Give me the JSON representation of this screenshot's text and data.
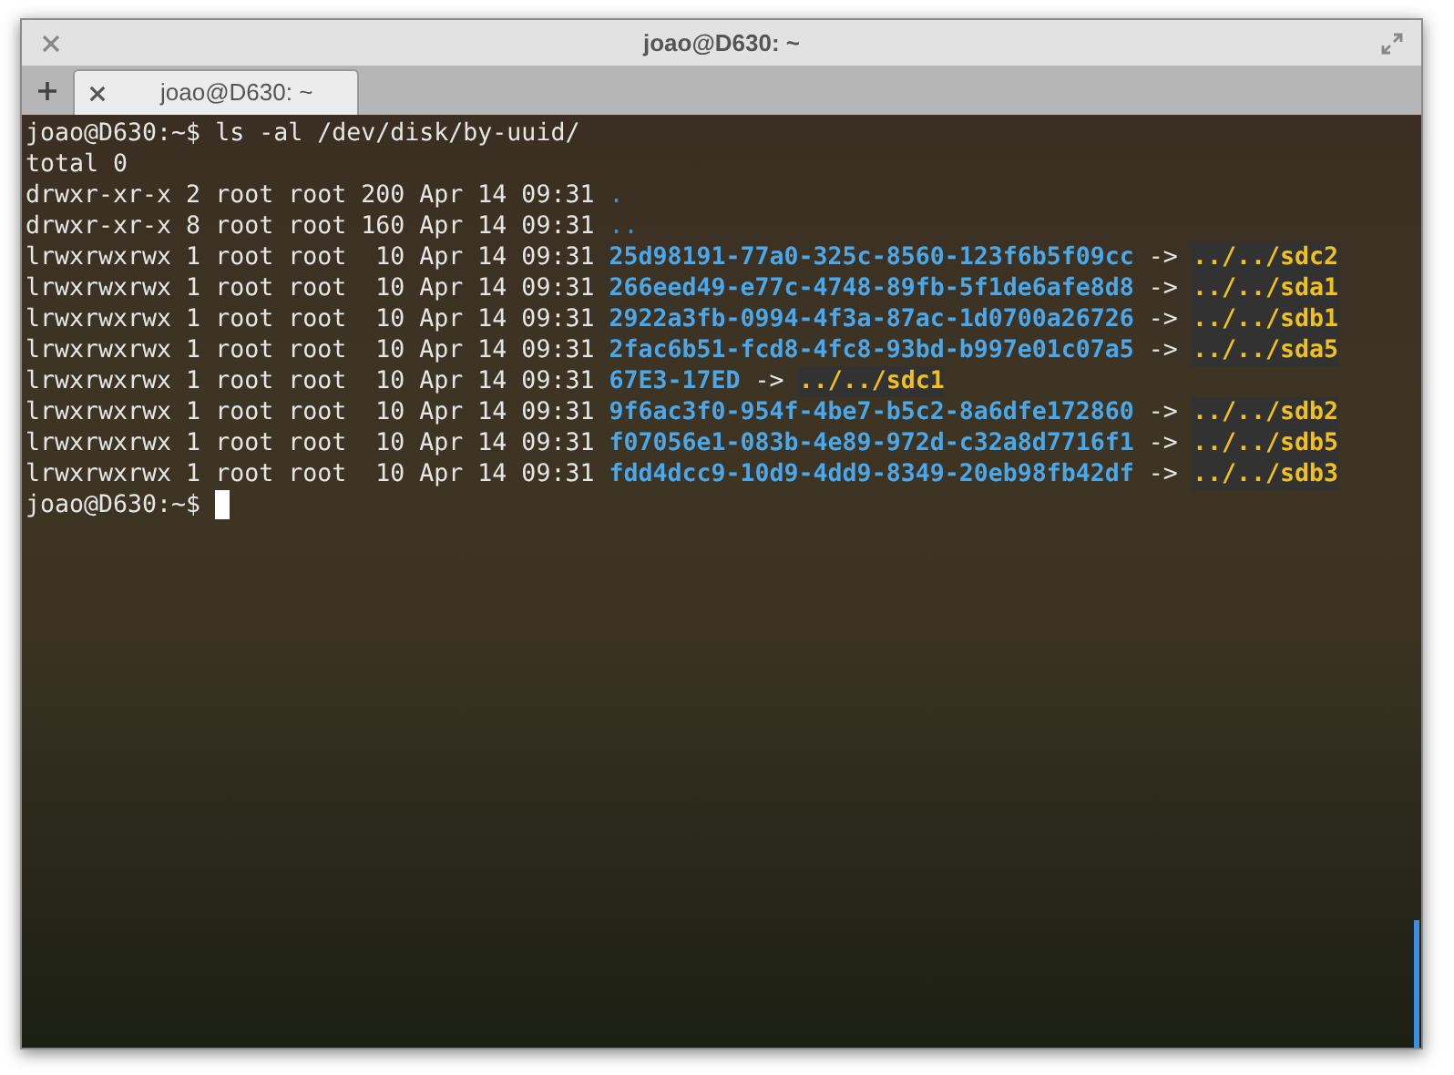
{
  "window": {
    "title": "joao@D630: ~"
  },
  "tabs": [
    {
      "label": "joao@D630: ~",
      "selected": true
    }
  ],
  "terminal": {
    "lines": [
      {
        "segments": [
          {
            "kind": "plain",
            "text": "joao@D630:~$ ls -al /dev/disk/by-uuid/"
          }
        ]
      },
      {
        "segments": [
          {
            "kind": "plain",
            "text": "total 0"
          }
        ]
      },
      {
        "segments": [
          {
            "kind": "plain",
            "text": "drwxr-xr-x 2 root root 200 Apr 14 09:31 "
          },
          {
            "kind": "dir",
            "text": "."
          }
        ]
      },
      {
        "segments": [
          {
            "kind": "plain",
            "text": "drwxr-xr-x 8 root root 160 Apr 14 09:31 "
          },
          {
            "kind": "dir",
            "text": ".."
          }
        ]
      },
      {
        "segments": [
          {
            "kind": "plain",
            "text": "lrwxrwxrwx 1 root root  10 Apr 14 09:31 "
          },
          {
            "kind": "link",
            "text": "25d98191-77a0-325c-8560-123f6b5f09cc"
          },
          {
            "kind": "plain",
            "text": " -> "
          },
          {
            "kind": "target",
            "text": "../../sdc2"
          }
        ]
      },
      {
        "segments": [
          {
            "kind": "plain",
            "text": "lrwxrwxrwx 1 root root  10 Apr 14 09:31 "
          },
          {
            "kind": "link",
            "text": "266eed49-e77c-4748-89fb-5f1de6afe8d8"
          },
          {
            "kind": "plain",
            "text": " -> "
          },
          {
            "kind": "target",
            "text": "../../sda1"
          }
        ]
      },
      {
        "segments": [
          {
            "kind": "plain",
            "text": "lrwxrwxrwx 1 root root  10 Apr 14 09:31 "
          },
          {
            "kind": "link",
            "text": "2922a3fb-0994-4f3a-87ac-1d0700a26726"
          },
          {
            "kind": "plain",
            "text": " -> "
          },
          {
            "kind": "target",
            "text": "../../sdb1"
          }
        ]
      },
      {
        "segments": [
          {
            "kind": "plain",
            "text": "lrwxrwxrwx 1 root root  10 Apr 14 09:31 "
          },
          {
            "kind": "link",
            "text": "2fac6b51-fcd8-4fc8-93bd-b997e01c07a5"
          },
          {
            "kind": "plain",
            "text": " -> "
          },
          {
            "kind": "target",
            "text": "../../sda5"
          }
        ]
      },
      {
        "segments": [
          {
            "kind": "plain",
            "text": "lrwxrwxrwx 1 root root  10 Apr 14 09:31 "
          },
          {
            "kind": "link",
            "text": "67E3-17ED"
          },
          {
            "kind": "plain",
            "text": " -> "
          },
          {
            "kind": "target",
            "text": "../../sdc1"
          }
        ]
      },
      {
        "segments": [
          {
            "kind": "plain",
            "text": "lrwxrwxrwx 1 root root  10 Apr 14 09:31 "
          },
          {
            "kind": "link",
            "text": "9f6ac3f0-954f-4be7-b5c2-8a6dfe172860"
          },
          {
            "kind": "plain",
            "text": " -> "
          },
          {
            "kind": "target",
            "text": "../../sdb2"
          }
        ]
      },
      {
        "segments": [
          {
            "kind": "plain",
            "text": "lrwxrwxrwx 1 root root  10 Apr 14 09:31 "
          },
          {
            "kind": "link",
            "text": "f07056e1-083b-4e89-972d-c32a8d7716f1"
          },
          {
            "kind": "plain",
            "text": " -> "
          },
          {
            "kind": "target",
            "text": "../../sdb5"
          }
        ]
      },
      {
        "segments": [
          {
            "kind": "plain",
            "text": "lrwxrwxrwx 1 root root  10 Apr 14 09:31 "
          },
          {
            "kind": "link",
            "text": "fdd4dcc9-10d9-4dd9-8349-20eb98fb42df"
          },
          {
            "kind": "plain",
            "text": " -> "
          },
          {
            "kind": "target",
            "text": "../../sdb3"
          }
        ]
      },
      {
        "segments": [
          {
            "kind": "plain",
            "text": "joao@D630:~$ "
          },
          {
            "kind": "cursor"
          }
        ]
      }
    ]
  }
}
